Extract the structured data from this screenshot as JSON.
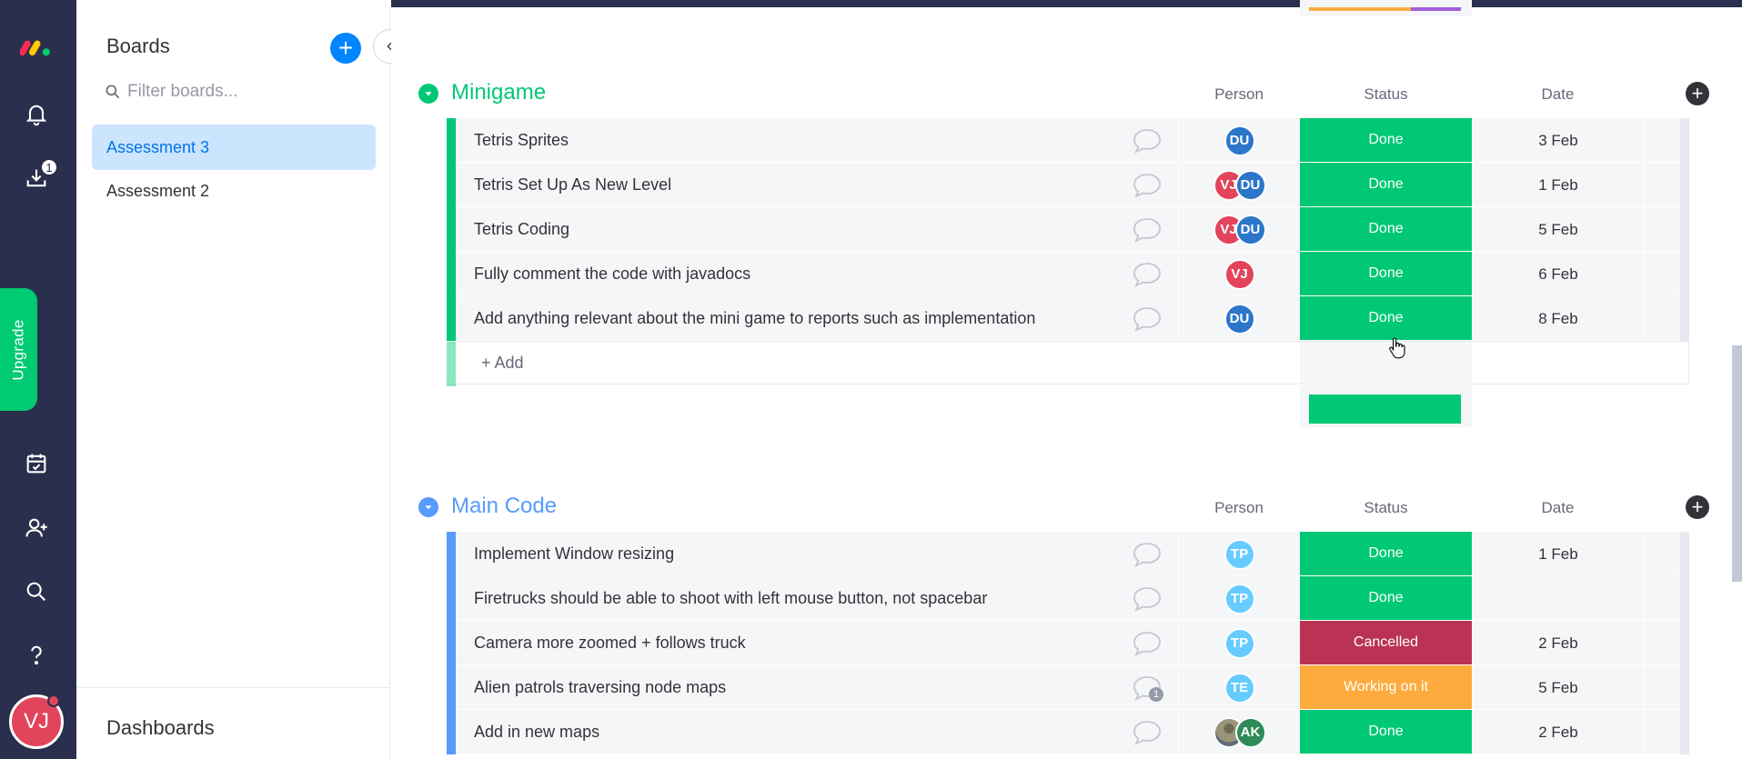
{
  "rail": {
    "notifications_badge": "",
    "inbox_badge": "1",
    "upgrade_label": "Upgrade",
    "user_initials": "VJ"
  },
  "boards": {
    "title": "Boards",
    "filter_placeholder": "Filter boards...",
    "items": [
      {
        "label": "Assessment 3",
        "active": true
      },
      {
        "label": "Assessment 2",
        "active": false
      }
    ],
    "dashboards_title": "Dashboards"
  },
  "colors": {
    "done": "#00c875",
    "cancelled": "#bb3354",
    "working": "#fdab3d",
    "minigame": "#00c875",
    "main_code": "#579bfc"
  },
  "columns": {
    "person": "Person",
    "status": "Status",
    "date": "Date"
  },
  "groups": [
    {
      "name": "Minigame",
      "color": "#00c875",
      "add_placeholder": "+ Add",
      "rows": [
        {
          "name": "Tetris Sprites",
          "people": [
            {
              "initials": "DU",
              "color": "#2b76c9"
            }
          ],
          "status": "Done",
          "status_color": "#00c875",
          "date": "3 Feb",
          "comments": ""
        },
        {
          "name": "Tetris Set Up As New Level",
          "people": [
            {
              "initials": "VJ",
              "color": "#e2445c"
            },
            {
              "initials": "DU",
              "color": "#2b76c9"
            }
          ],
          "status": "Done",
          "status_color": "#00c875",
          "date": "1 Feb",
          "comments": ""
        },
        {
          "name": "Tetris Coding",
          "people": [
            {
              "initials": "VJ",
              "color": "#e2445c"
            },
            {
              "initials": "DU",
              "color": "#2b76c9"
            }
          ],
          "status": "Done",
          "status_color": "#00c875",
          "date": "5 Feb",
          "comments": ""
        },
        {
          "name": "Fully comment the code with javadocs",
          "people": [
            {
              "initials": "VJ",
              "color": "#e2445c"
            }
          ],
          "status": "Done",
          "status_color": "#00c875",
          "date": "6 Feb",
          "comments": ""
        },
        {
          "name": "Add anything relevant about the mini game to reports such as implementation",
          "people": [
            {
              "initials": "DU",
              "color": "#2b76c9"
            }
          ],
          "status": "Done",
          "status_color": "#00c875",
          "date": "8 Feb",
          "comments": ""
        }
      ]
    },
    {
      "name": "Main Code",
      "color": "#579bfc",
      "rows": [
        {
          "name": "Implement Window resizing",
          "people": [
            {
              "initials": "TP",
              "color": "#66ccff"
            }
          ],
          "status": "Done",
          "status_color": "#00c875",
          "date": "1 Feb",
          "comments": ""
        },
        {
          "name": "Firetrucks should be able to shoot with left mouse button, not spacebar",
          "people": [
            {
              "initials": "TP",
              "color": "#66ccff"
            }
          ],
          "status": "Done",
          "status_color": "#00c875",
          "date": "",
          "comments": ""
        },
        {
          "name": "Camera more zoomed + follows truck",
          "people": [
            {
              "initials": "TP",
              "color": "#66ccff"
            }
          ],
          "status": "Cancelled",
          "status_color": "#bb3354",
          "date": "2 Feb",
          "comments": ""
        },
        {
          "name": "Alien patrols traversing node maps",
          "people": [
            {
              "initials": "TE",
              "color": "#66ccff"
            }
          ],
          "status": "Working on it",
          "status_color": "#fdab3d",
          "date": "5 Feb",
          "comments": "1"
        },
        {
          "name": "Add in new maps",
          "people": [
            {
              "initials": "",
              "color": "photo"
            },
            {
              "initials": "AK",
              "color": "#2e8b57"
            }
          ],
          "status": "Done",
          "status_color": "#00c875",
          "date": "2 Feb",
          "comments": ""
        }
      ]
    }
  ]
}
